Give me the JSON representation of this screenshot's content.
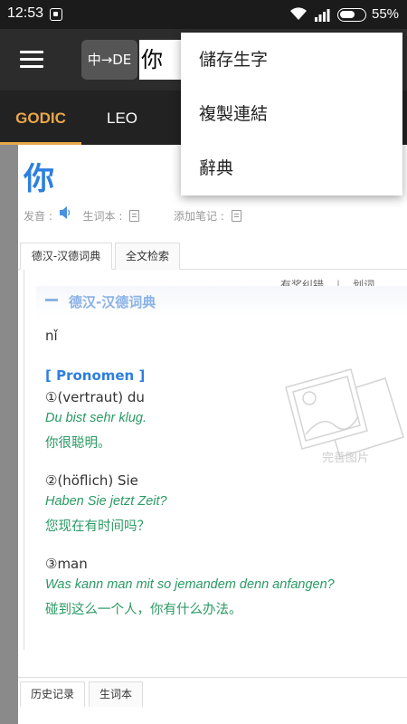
{
  "status_bar": {
    "time": "12:53",
    "battery": "55%"
  },
  "app_bar": {
    "lang_toggle": "中→DE",
    "search_value": "你"
  },
  "tabs": [
    {
      "label": "GODIC"
    },
    {
      "label": "LEO"
    }
  ],
  "dropdown_menu": [
    {
      "label": "儲存生字"
    },
    {
      "label": "複製連結"
    },
    {
      "label": "辭典"
    }
  ],
  "entry": {
    "head_word": "你",
    "pronounce_label": "发音 :",
    "vocab_label": "生词本 :",
    "note_label": "添加笔记 :",
    "dict_tabs": [
      "德汉-汉德词典",
      "全文检索"
    ],
    "report_label": "有奖纠错",
    "divider": "|",
    "mark_label": "划词",
    "dict_header": "德汉-汉德词典",
    "pinyin": "nǐ",
    "pos": "[ Pronomen ]",
    "senses": [
      {
        "def": "①(vertraut) du",
        "de": "Du bist sehr klug.",
        "zh": "你很聪明。"
      },
      {
        "def": "②(höflich) Sie",
        "de": "Haben Sie jetzt Zeit?",
        "zh": "您现在有时间吗？"
      },
      {
        "def": "③man",
        "de": "Was kann man mit so jemandem denn anfangen?",
        "zh": "碰到这么一个人，你有什么办法。"
      }
    ],
    "image_caption": "完善图片"
  },
  "bottom_tabs": [
    "历史记录",
    "生词本"
  ],
  "colors": {
    "accent": "#e8a64a",
    "link_blue": "#2d7fe0",
    "example_green": "#2a9a63"
  }
}
